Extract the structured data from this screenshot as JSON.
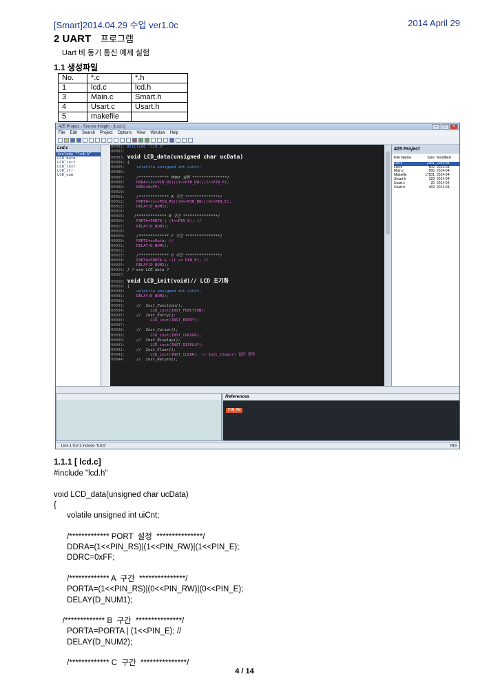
{
  "header": {
    "left": "[Smart]2014.04.29 수업 ver1.0c",
    "right": "2014 April 29"
  },
  "section": {
    "title": "2 UART",
    "title_ko": "프로그램",
    "subtitle": "Uart 비 동기 통신 예제 실험"
  },
  "subsection": {
    "title": "1.1 생성파일"
  },
  "file_table": {
    "header": [
      "No.",
      "*.c",
      "*.h"
    ],
    "rows": [
      [
        "1",
        "lcd.c",
        "lcd.h"
      ],
      [
        "3",
        "Main.c",
        "Smart.h"
      ],
      [
        "4",
        "Usart.c",
        "Usart.h"
      ],
      [
        "5",
        "makefile",
        ""
      ]
    ]
  },
  "ide": {
    "window_title": "425 Project - Source Insight - [Lcd.c]",
    "menu": [
      "File",
      "Edit",
      "Search",
      "Project",
      "Options",
      "View",
      "Window",
      "Help"
    ],
    "left_pane_title": "Lcd.c",
    "symbols": [
      "include \"lcd.h\"",
      "LCD_data",
      "LCD_init",
      "LCD_inst",
      "LCD_str",
      "LCD_num"
    ],
    "right_pane_title": "425 Project",
    "file_columns": [
      "File Name",
      "Size",
      "Modified"
    ],
    "files": [
      [
        "Lcd.c",
        "2301",
        "2014-04-"
      ],
      [
        "Lcd.h",
        "502",
        "2014-04-"
      ],
      [
        "Main.c",
        "856",
        "2014-04-"
      ],
      [
        "Makefile",
        "17501",
        "2014-04-"
      ],
      [
        "Smart.h",
        "329",
        "2014-04-"
      ],
      [
        "Usart.c",
        "20",
        "2014-04-"
      ],
      [
        "Usart.h",
        "469",
        "2014-04-"
      ]
    ],
    "references_title": "References",
    "reference_item": "PIN_RW",
    "status": "Line 1  Col 1  include \"lcd.h\"",
    "status_mode": "INS",
    "code_lines": [
      [
        "00001:",
        "#include \"lcd.h\""
      ],
      [
        "00002:",
        ""
      ],
      [
        "00003:",
        "void LCD_data(unsigned char ucData)"
      ],
      [
        "00004:",
        "{"
      ],
      [
        "00005:",
        "    volatile unsigned int uiCnt;"
      ],
      [
        "00006:",
        ""
      ],
      [
        "00007:",
        "    /************* PORT 설정 ***************/"
      ],
      [
        "00008:",
        "    DDRA=(1<<PIN_RS)|(1<<PIN_RW)|(1<<PIN_E);"
      ],
      [
        "00009:",
        "    DDRC=0xFF;"
      ],
      [
        "00010:",
        ""
      ],
      [
        "00011:",
        "    /************* A 구간 ***************/"
      ],
      [
        "00012:",
        "    PORTA=(1<<PIN_RS)|(0<<PIN_RW)|(0<<PIN_E);"
      ],
      [
        "00013:",
        "    DELAY(D_NUM1);"
      ],
      [
        "00014:",
        ""
      ],
      [
        "00015:",
        "   /************* B 구간 ***************/"
      ],
      [
        "00016:",
        "    PORTA=PORTA | (1<<PIN_E); //"
      ],
      [
        "00017:",
        "    DELAY(D_NUM2);"
      ],
      [
        "00018:",
        ""
      ],
      [
        "00019:",
        "    /************* C 구간 ***************/"
      ],
      [
        "00020:",
        "    PORTC=ucData; //"
      ],
      [
        "00021:",
        "    DELAY(D_NUM1);"
      ],
      [
        "00022:",
        ""
      ],
      [
        "00023:",
        "    /************* D 구간 ***************/"
      ],
      [
        "00024:",
        "    PORTA=PORTA & ~(1 << PIN_E); //"
      ],
      [
        "00025:",
        "    DELAY(D_NUM2);"
      ],
      [
        "00026:",
        "} ? end LCD_data ?"
      ],
      [
        "00027:",
        ""
      ],
      [
        "00028:",
        "void LCD_init(void)// LCD 초기화"
      ],
      [
        "00029:",
        "{"
      ],
      [
        "00030:",
        "    volatile unsigned int uiCnt;"
      ],
      [
        "00031:",
        "    DELAY(D_NUM2);"
      ],
      [
        "00032:",
        ""
      ],
      [
        "00033:",
        "    //  Inst_Function();"
      ],
      [
        "00034:",
        "          LCD_inst(INST_FUNCTION);"
      ],
      [
        "00035:",
        "    //  Inst_Entry();"
      ],
      [
        "00036:",
        "          LCD_inst(INST_ENTRY);"
      ],
      [
        "00037:",
        ""
      ],
      [
        "00038:",
        "    //  Inst_Cursor();"
      ],
      [
        "00039:",
        "          LCD_inst(INST_CURSOR);"
      ],
      [
        "00040:",
        "    //  Inst_Display();"
      ],
      [
        "00041:",
        "          LCD_inst(INST_DISPLAY);"
      ],
      [
        "00042:",
        "    //  Inst_Clear();"
      ],
      [
        "00043:",
        "          LCD_inst(INST_CLEAR); // Inst_Clear() 같은 동작"
      ],
      [
        "00044:",
        "    //  Inst_Return();"
      ]
    ]
  },
  "subsubsection": {
    "title": "1.1.1 [ lcd.c]"
  },
  "body_code": [
    "#include \"lcd.h\"",
    "",
    "void LCD_data(unsigned char ucData)",
    "{",
    "      volatile unsigned int uiCnt;",
    "",
    "      /************* PORT  설정  ***************/",
    "      DDRA=(1<<PIN_RS)|(1<<PIN_RW)|(1<<PIN_E);",
    "      DDRC=0xFF;",
    "",
    "      /************* A  구간  ***************/",
    "      PORTA=(1<<PIN_RS)|(0<<PIN_RW)|(0<<PIN_E);",
    "      DELAY(D_NUM1);",
    "",
    "    /************* B  구간  ***************/",
    "      PORTA=PORTA | (1<<PIN_E); //",
    "      DELAY(D_NUM2);",
    "",
    "      /************* C  구간  ***************/"
  ],
  "footer": {
    "page": "4 / 14"
  }
}
